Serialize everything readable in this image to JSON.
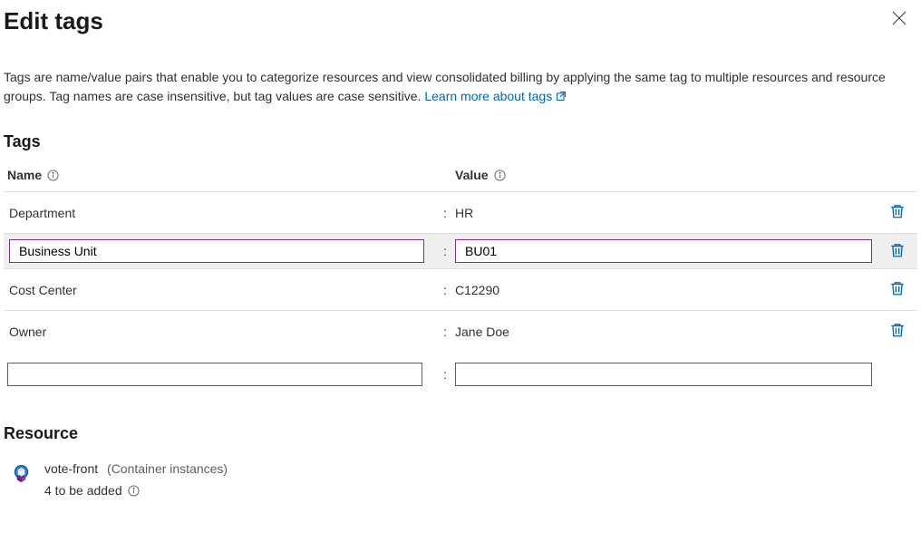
{
  "header": {
    "title": "Edit tags"
  },
  "description": {
    "text": "Tags are name/value pairs that enable you to categorize resources and view consolidated billing by applying the same tag to multiple resources and resource groups. Tag names are case insensitive, but tag values are case sensitive. ",
    "link_text": "Learn more about tags"
  },
  "tags_section": {
    "heading": "Tags",
    "name_header": "Name",
    "value_header": "Value",
    "rows": [
      {
        "name": "Department",
        "value": "HR"
      },
      {
        "name": "Business Unit",
        "value": "BU01"
      },
      {
        "name": "Cost Center",
        "value": "C12290"
      },
      {
        "name": "Owner",
        "value": "Jane Doe"
      }
    ]
  },
  "resource_section": {
    "heading": "Resource",
    "name": "vote-front",
    "type": "(Container instances)",
    "status": "4 to be added"
  }
}
